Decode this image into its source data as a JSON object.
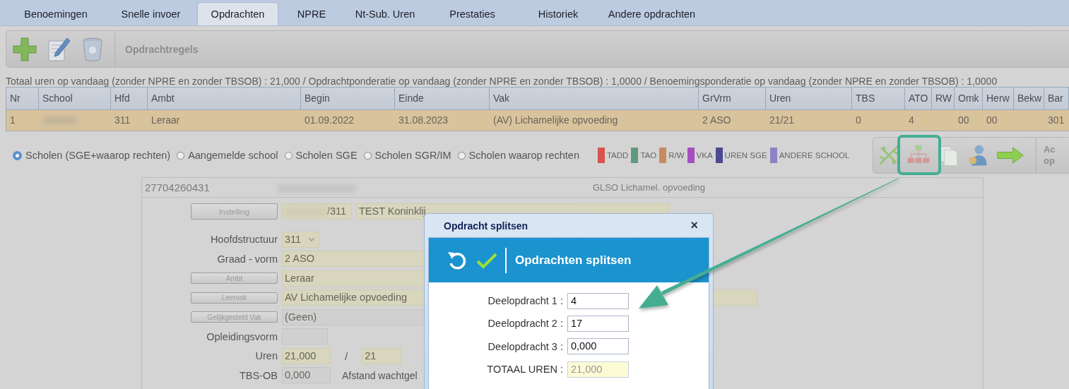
{
  "tabs": [
    {
      "label": "Benoemingen",
      "selected": false
    },
    {
      "label": "Snelle invoer",
      "selected": false
    },
    {
      "label": "Opdrachten",
      "selected": true
    },
    {
      "label": "NPRE",
      "selected": false
    },
    {
      "label": "Nt-Sub. Uren",
      "selected": false
    },
    {
      "label": "Prestaties",
      "selected": false
    },
    {
      "label": "Historiek",
      "selected": false
    },
    {
      "label": "Andere opdrachten",
      "selected": false
    }
  ],
  "toolbar": {
    "title": "Opdrachtregels"
  },
  "totals": "Totaal uren op vandaag (zonder NPRE en zonder TBSOB) : 21,000 / Opdrachtponderatie op vandaag (zonder NPRE en zonder TBSOB) : 1,0000 / Benoemingsponderatie op vandaag (zonder NPRE en zonder TBSOB) : 1,0000",
  "table": {
    "columns": [
      "Nr",
      "School",
      "Hfd",
      "Ambt",
      "Begin",
      "Einde",
      "Vak",
      "GrVrm",
      "Uren",
      "TBS",
      "ATO",
      "RW",
      "Omk",
      "Herw",
      "Bekw",
      "Bar"
    ],
    "rows": [
      {
        "selected": true,
        "cells": [
          {
            "kind": "text",
            "text": "1"
          },
          {
            "kind": "redacted"
          },
          {
            "kind": "text",
            "text": "311"
          },
          {
            "kind": "text",
            "text": "Leraar"
          },
          {
            "kind": "text",
            "text": "01.09.2022"
          },
          {
            "kind": "text",
            "text": "31.08.2023"
          },
          {
            "kind": "text",
            "text": "(AV) Lichamelijke opvoeding"
          },
          {
            "kind": "text",
            "text": "2 ASO"
          },
          {
            "kind": "text",
            "text": "21/21"
          },
          {
            "kind": "text",
            "text": "0"
          },
          {
            "kind": "text",
            "text": "4"
          },
          {
            "kind": "text",
            "text": ""
          },
          {
            "kind": "text",
            "text": "00"
          },
          {
            "kind": "text",
            "text": "00"
          },
          {
            "kind": "text",
            "text": ""
          },
          {
            "kind": "text",
            "text": "301"
          }
        ]
      }
    ]
  },
  "school_filter": [
    {
      "label": "Scholen (SGE+waarop rechten)",
      "selected": true
    },
    {
      "label": "Aangemelde school",
      "selected": false
    },
    {
      "label": "Scholen SGE",
      "selected": false
    },
    {
      "label": "Scholen SGR/IM",
      "selected": false
    },
    {
      "label": "Scholen waarop rechten",
      "selected": false
    }
  ],
  "legend": [
    {
      "label": "TADD",
      "color": "#d9534f"
    },
    {
      "label": "TAO",
      "color": "#5f9a7c"
    },
    {
      "label": "R/W",
      "color": "#c98a5e"
    },
    {
      "label": "VKA",
      "color": "#a64fbf"
    },
    {
      "label": "UREN SGE",
      "color": "#4b4a93"
    },
    {
      "label": "ANDERE SCHOOL",
      "color": "#8e82c4"
    }
  ],
  "side_toolbar": {
    "label_line_1": "Ac",
    "label_line_2": "op"
  },
  "form": {
    "id": "27704260431",
    "subject": "GLSO Lichamel. opvoeding",
    "instelling": {
      "button": "Instelling",
      "code": "/311",
      "name": "TEST Koninklij"
    },
    "hoofdstructuur": {
      "label": "Hoofdstructuur",
      "value": "311"
    },
    "graad_vorm": {
      "label": "Graad - vorm",
      "value": "2 ASO"
    },
    "ambt": {
      "button": "Ambt",
      "value": "Leraar"
    },
    "leervak": {
      "button": "Leervak",
      "value": "AV Lichamelijke opvoeding"
    },
    "gelijkgesteld_vak": {
      "button": "Gelijkgesteld Vak",
      "value": "(Geen)"
    },
    "opleidingsvorm": {
      "label": "Opleidingsvorm"
    },
    "uren": {
      "label": "Uren",
      "value": "21,000",
      "separator": "/",
      "max": "21"
    },
    "tbs_ob": {
      "label": "TBS-OB",
      "value": "0,000",
      "note": "Afstand wachtgel"
    }
  },
  "dialog": {
    "title": "Opdracht splitsen",
    "close": "×",
    "header": "Opdrachten splitsen",
    "fields": [
      {
        "label": "Deelopdracht 1 :",
        "value": "4",
        "readonly": false
      },
      {
        "label": "Deelopdracht 2 :",
        "value": "17",
        "readonly": false
      },
      {
        "label": "Deelopdracht 3 :",
        "value": "0,000",
        "readonly": false
      },
      {
        "label": "TOTAAL UREN :",
        "value": "21,000",
        "readonly": true
      }
    ]
  }
}
